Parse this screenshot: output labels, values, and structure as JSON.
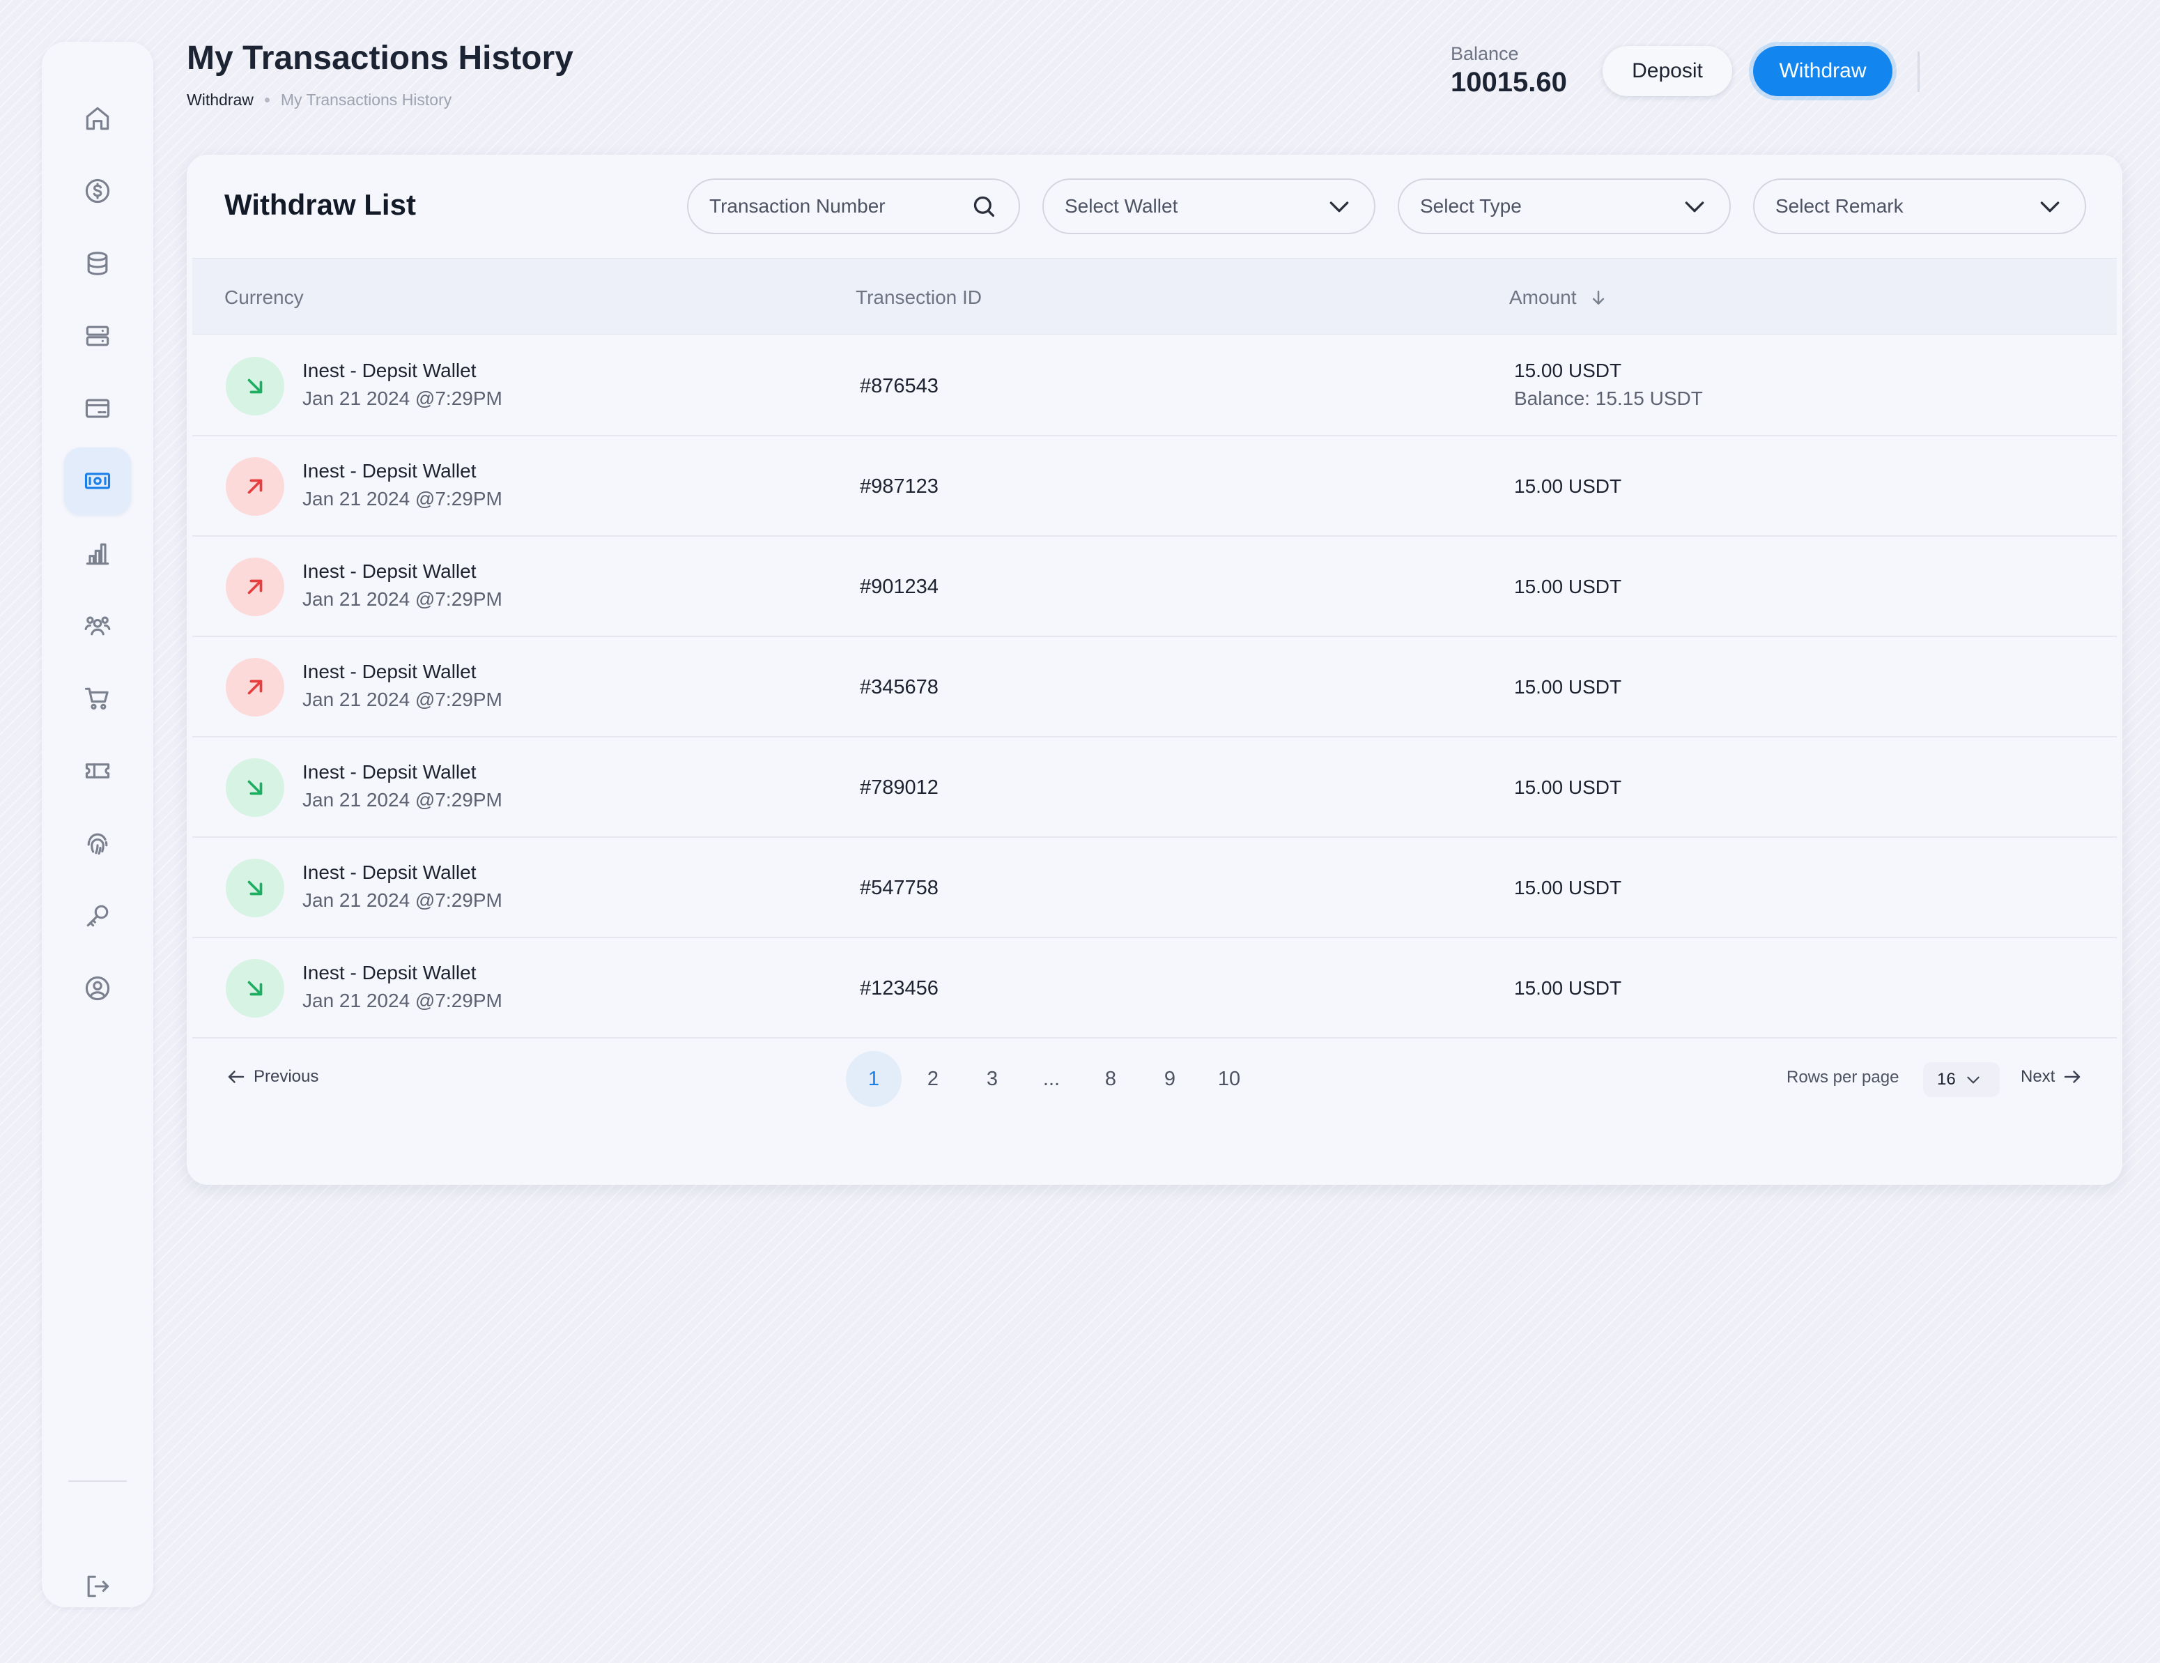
{
  "header": {
    "title": "My Transactions History",
    "breadcrumb": [
      "Withdraw",
      "My Transactions History"
    ],
    "balance_label": "Balance",
    "balance_value": "10015.60",
    "deposit_label": "Deposit",
    "withdraw_label": "Withdraw"
  },
  "sidebar": {
    "items": [
      {
        "icon": "home-icon"
      },
      {
        "icon": "dollar-coin-icon"
      },
      {
        "icon": "database-icon"
      },
      {
        "icon": "server-icon"
      },
      {
        "icon": "credit-card-icon"
      },
      {
        "icon": "money-bill-icon",
        "active": true
      },
      {
        "icon": "bar-chart-icon"
      },
      {
        "icon": "users-icon"
      },
      {
        "icon": "shopping-cart-icon"
      },
      {
        "icon": "ticket-icon"
      },
      {
        "icon": "fingerprint-icon"
      },
      {
        "icon": "key-icon"
      },
      {
        "icon": "user-circle-icon"
      }
    ],
    "logout_icon": "logout-icon"
  },
  "card": {
    "title": "Withdraw List",
    "search_placeholder": "Transaction Number",
    "filters": [
      "Select Wallet",
      "Select Type",
      "Select Remark"
    ]
  },
  "table": {
    "columns": [
      "Currency",
      "Transection ID",
      "Amount"
    ],
    "rows": [
      {
        "direction": "in",
        "wallet": "Inest - Depsit Wallet",
        "date": "Jan 21 2024 @7:29PM",
        "id": "#876543",
        "amount": "15.00 USDT",
        "balance": "Balance: 15.15 USDT"
      },
      {
        "direction": "out",
        "wallet": "Inest - Depsit Wallet",
        "date": "Jan 21 2024 @7:29PM",
        "id": "#987123",
        "amount": "15.00 USDT"
      },
      {
        "direction": "out",
        "wallet": "Inest - Depsit Wallet",
        "date": "Jan 21 2024 @7:29PM",
        "id": "#901234",
        "amount": "15.00 USDT"
      },
      {
        "direction": "out",
        "wallet": "Inest - Depsit Wallet",
        "date": "Jan 21 2024 @7:29PM",
        "id": "#345678",
        "amount": "15.00 USDT"
      },
      {
        "direction": "in",
        "wallet": "Inest - Depsit Wallet",
        "date": "Jan 21 2024 @7:29PM",
        "id": "#789012",
        "amount": "15.00 USDT"
      },
      {
        "direction": "in",
        "wallet": "Inest - Depsit Wallet",
        "date": "Jan 21 2024 @7:29PM",
        "id": "#547758",
        "amount": "15.00 USDT"
      },
      {
        "direction": "in",
        "wallet": "Inest - Depsit Wallet",
        "date": "Jan 21 2024 @7:29PM",
        "id": "#123456",
        "amount": "15.00 USDT"
      }
    ]
  },
  "pagination": {
    "previous_label": "Previous",
    "next_label": "Next",
    "pages": [
      "1",
      "2",
      "3",
      "...",
      "8",
      "9",
      "10"
    ],
    "current_page": "1",
    "rows_per_page_label": "Rows per page",
    "rows_per_page_value": "16"
  },
  "colors": {
    "accent": "#1285ef",
    "incoming": "#1eae62",
    "outgoing": "#e53e3e"
  }
}
